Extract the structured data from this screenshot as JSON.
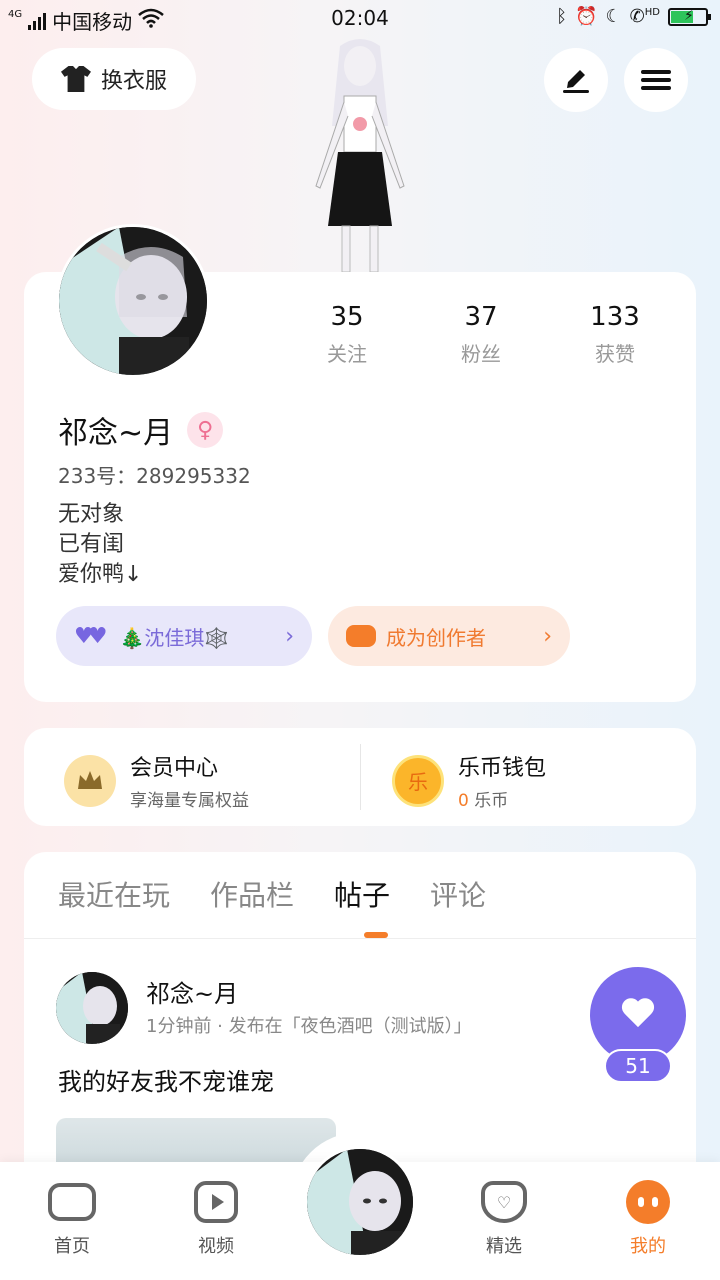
{
  "status_bar": {
    "network": "4G",
    "carrier": "中国移动",
    "time": "02:04",
    "hd": "HD"
  },
  "top_bar": {
    "wardrobe_label": "换衣服"
  },
  "profile": {
    "stats": [
      {
        "value": "35",
        "label": "关注"
      },
      {
        "value": "37",
        "label": "粉丝"
      },
      {
        "value": "133",
        "label": "获赞"
      }
    ],
    "name": "祁念~月",
    "gender_symbol": "♀",
    "uid": "233号：289295332",
    "bio": [
      "无对象",
      "已有闺",
      "爱你鸭↓"
    ],
    "tag_purple": "🎄沈佳琪🕸️",
    "tag_orange": "成为创作者"
  },
  "member": {
    "vip_title": "会员中心",
    "vip_sub": "享海量专属权益",
    "wallet_title": "乐币钱包",
    "wallet_count": "0",
    "wallet_unit": "乐币",
    "wallet_icon_char": "乐"
  },
  "tabs": [
    "最近在玩",
    "作品栏",
    "帖子",
    "评论"
  ],
  "active_tab": 2,
  "post": {
    "author": "祁念~月",
    "meta": "1分钟前 · 发布在「夜色酒吧（测试版）」",
    "text": "我的好友我不宠谁宠",
    "likes": "51"
  },
  "bottom_nav": [
    {
      "label": "首页"
    },
    {
      "label": "视频"
    },
    {
      "label": "精选"
    },
    {
      "label": "我的"
    }
  ],
  "colors": {
    "accent_orange": "#f47d2a",
    "accent_purple": "#7b6bec"
  }
}
